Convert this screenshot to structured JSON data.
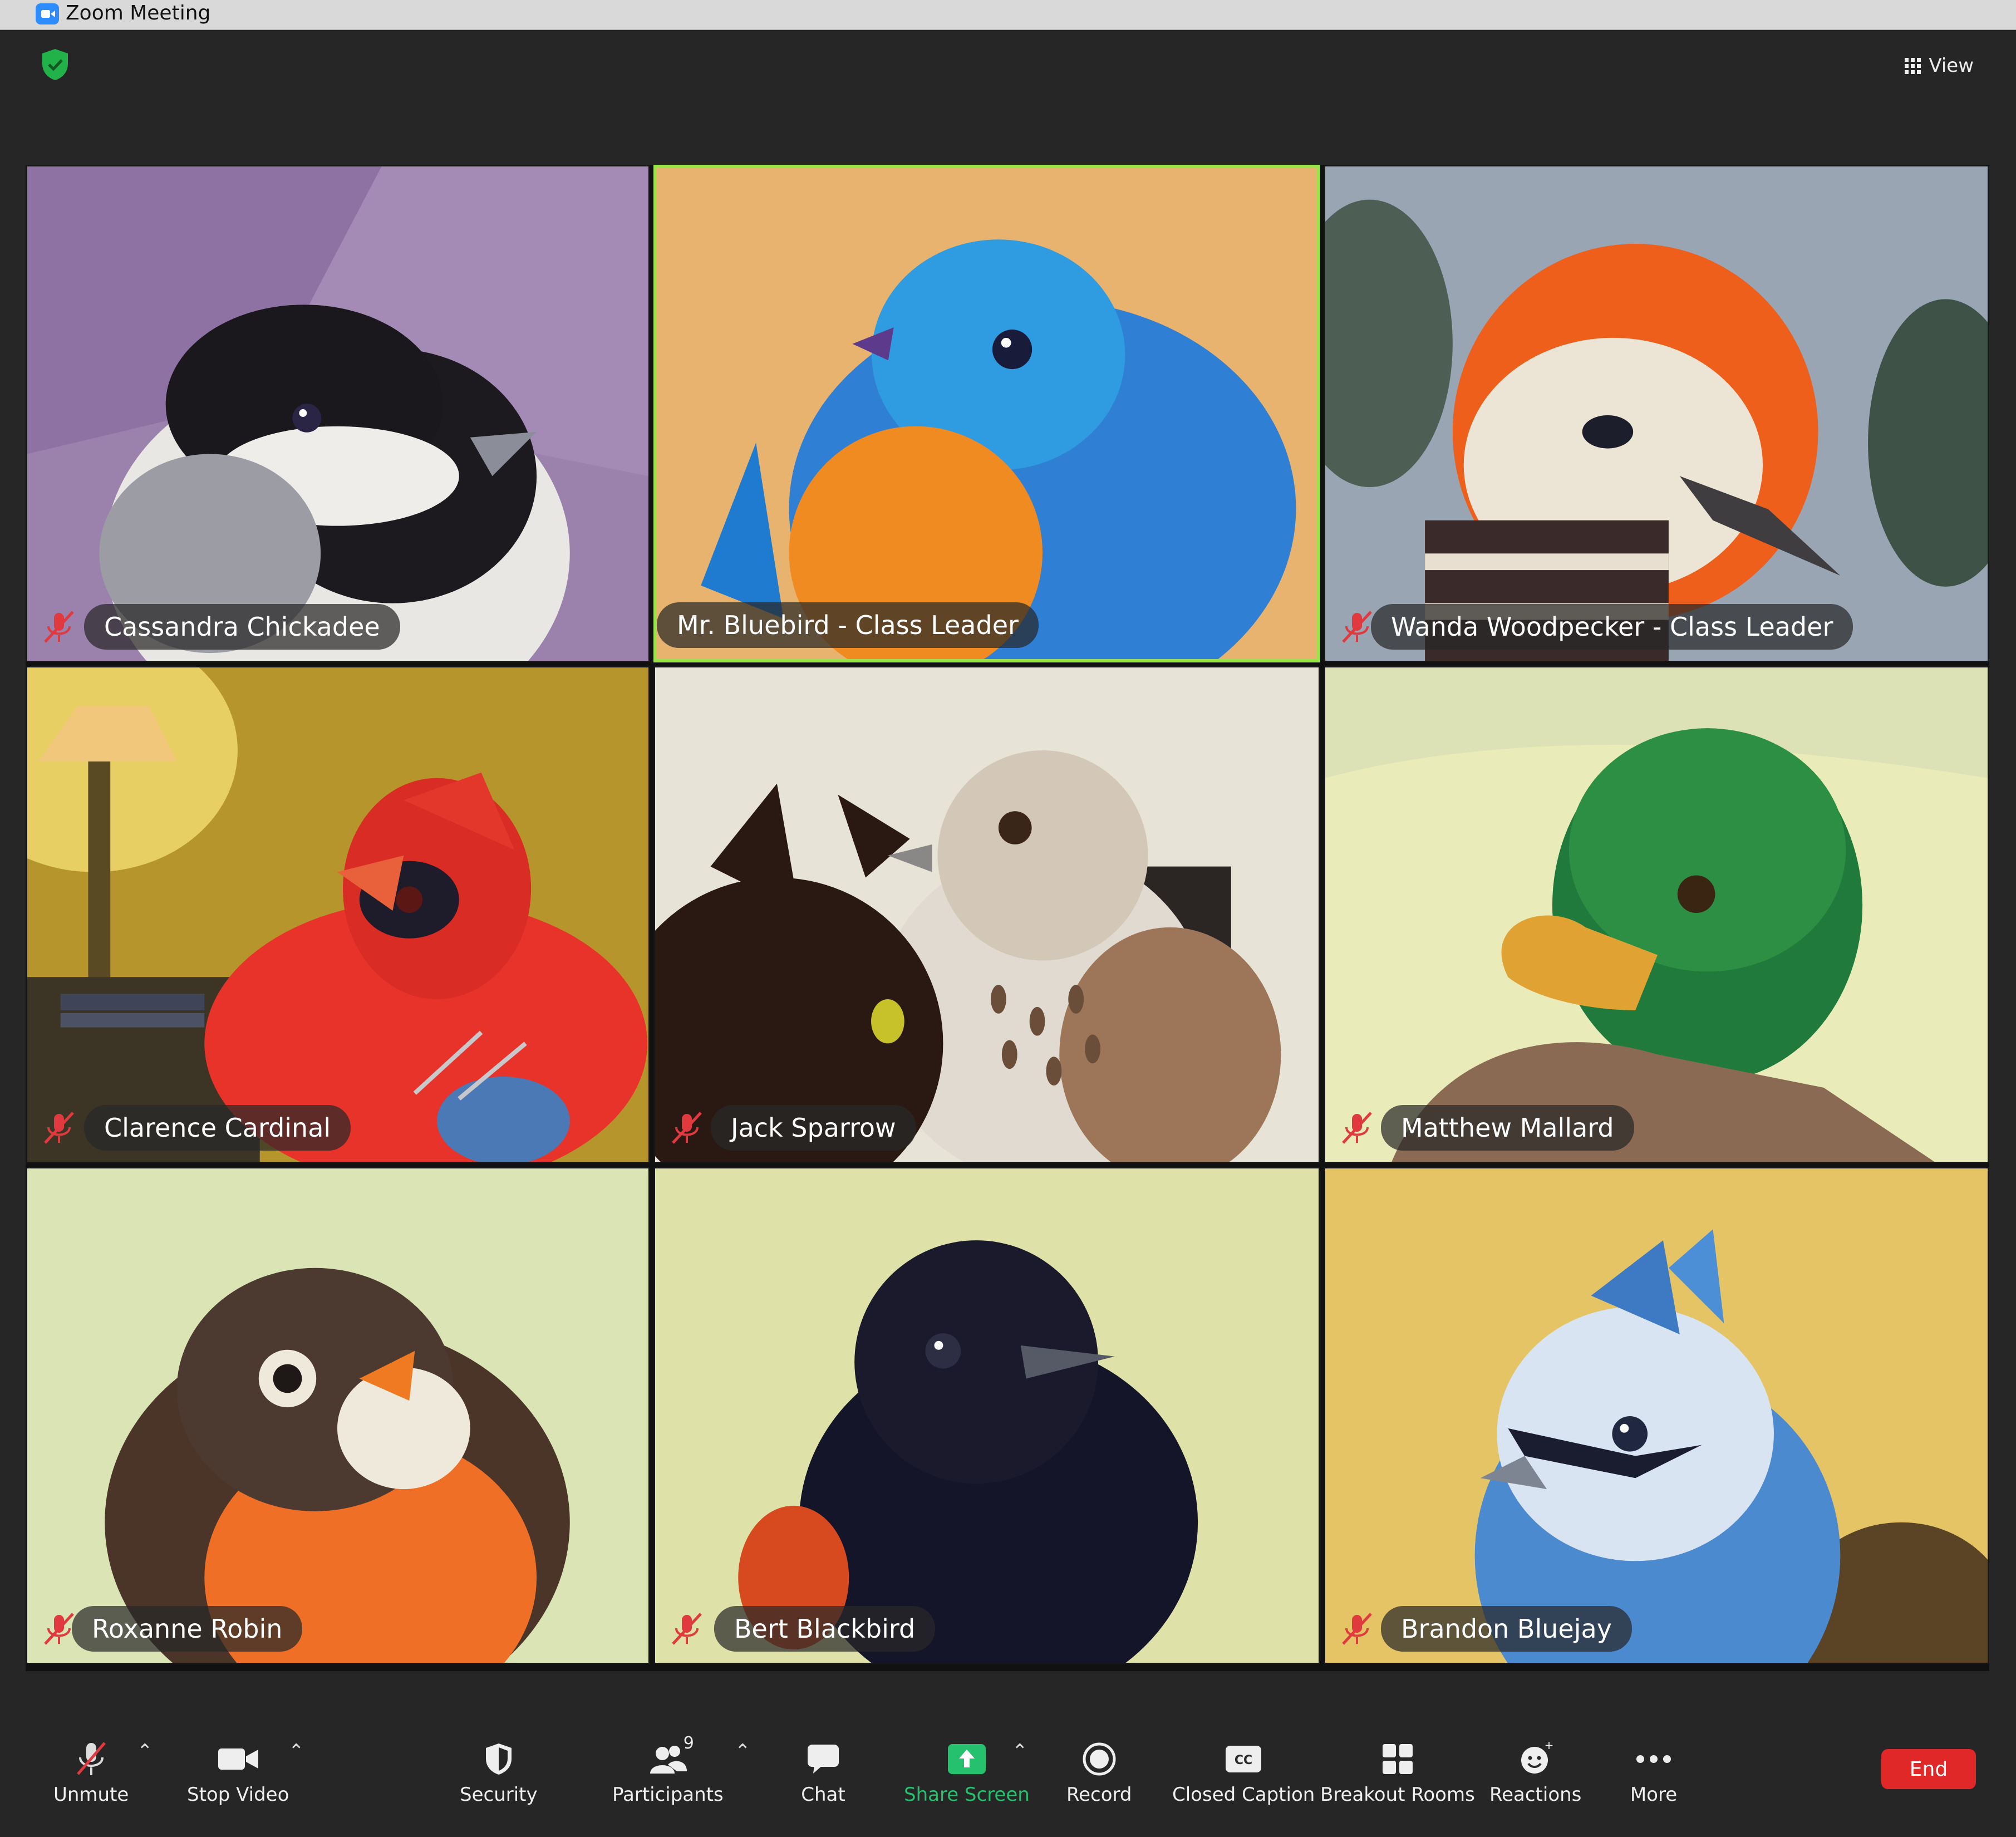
{
  "window": {
    "title": "Zoom Meeting"
  },
  "topbar": {
    "view_label": "View"
  },
  "participants": [
    {
      "name": "Cassandra Chickadee",
      "muted": true,
      "active": false
    },
    {
      "name": "Mr. Bluebird - Class Leader",
      "muted": false,
      "active": true
    },
    {
      "name": "Wanda Woodpecker - Class Leader",
      "muted": true,
      "active": false
    },
    {
      "name": "Clarence Cardinal",
      "muted": true,
      "active": false
    },
    {
      "name": "Jack Sparrow",
      "muted": true,
      "active": false
    },
    {
      "name": "Matthew Mallard",
      "muted": true,
      "active": false
    },
    {
      "name": "Roxanne Robin",
      "muted": true,
      "active": false
    },
    {
      "name": "Bert Blackbird",
      "muted": true,
      "active": false
    },
    {
      "name": "Brandon Bluejay",
      "muted": true,
      "active": false
    }
  ],
  "toolbar": {
    "unmute": "Unmute",
    "stop_video": "Stop Video",
    "security": "Security",
    "participants": "Participants",
    "participant_count": "9",
    "chat": "Chat",
    "share_screen": "Share Screen",
    "record": "Record",
    "closed_caption": "Closed Caption",
    "breakout_rooms": "Breakout Rooms",
    "reactions": "Reactions",
    "more": "More",
    "end": "End"
  },
  "colors": {
    "accent_active": "#9be34a",
    "share_green": "#25c16f",
    "end_red": "#e02828",
    "mute_red": "#e0393e"
  }
}
